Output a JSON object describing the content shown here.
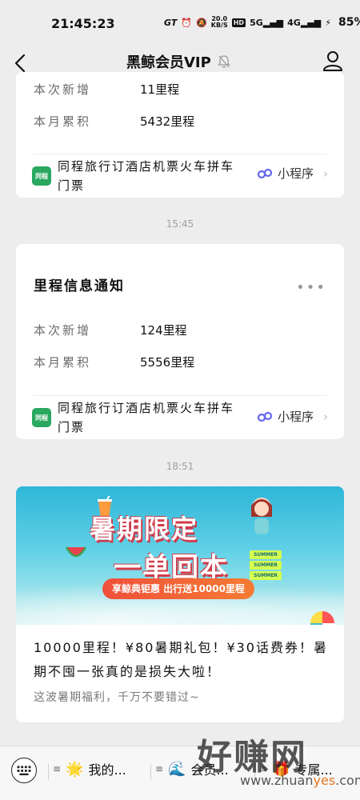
{
  "status_bar": {
    "time": "21:45:23",
    "speed": "20.0",
    "speed_unit": "KB/S",
    "hd": "HD",
    "net_a": "5G",
    "net_b": "4G",
    "battery": "85%"
  },
  "nav": {
    "title": "黑鲸会员VIP"
  },
  "card1": {
    "rows": [
      {
        "label": "本次新增",
        "value": "11里程"
      },
      {
        "label": "本月累积",
        "value": "5432里程"
      }
    ],
    "mini_program": {
      "logo_text": "同程",
      "name": "同程旅行订酒店机票火车拼车门票",
      "tag": "小程序"
    }
  },
  "timestamp1": "15:45",
  "card2": {
    "title": "里程信息通知",
    "more": "•••",
    "rows": [
      {
        "label": "本次新增",
        "value": "124里程"
      },
      {
        "label": "本月累积",
        "value": "5556里程"
      }
    ],
    "mini_program": {
      "logo_text": "同程",
      "name": "同程旅行订酒店机票火车拼车门票",
      "tag": "小程序"
    }
  },
  "timestamp2": "18:51",
  "promo": {
    "banner_line1": "暑期限定",
    "banner_line2": "一单回本",
    "banner_pill": "享鲸典钜惠 出行送10000里程",
    "summer": "SUMMER",
    "text": "10000里程！¥80暑期礼包！¥30话费券！暑期不囤一张真的是损失大啦！",
    "subtext": "这波暑期福利，千万不要错过~"
  },
  "bottom_bar": {
    "menu1": "我的...",
    "menu2": "会员...",
    "menu3": "专属..."
  },
  "watermark": {
    "big": "好赚网",
    "url_a": "www.zhuan",
    "url_b": "yes",
    "url_c": ".com"
  },
  "colors": {
    "background": "#ededed",
    "card": "#ffffff",
    "label_gray": "#6b6b6b",
    "banner_red": "#d23b4a",
    "pill_orange": "#f0503a"
  }
}
